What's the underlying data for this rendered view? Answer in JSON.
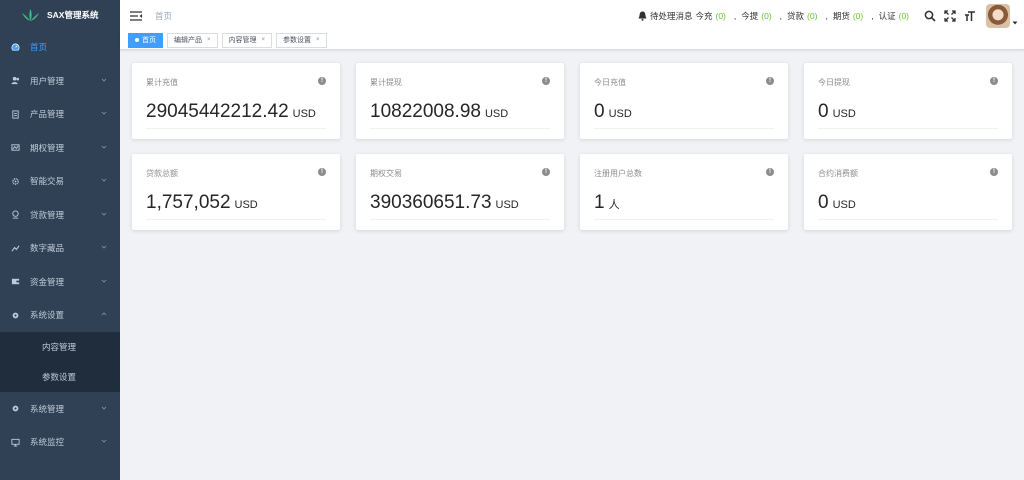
{
  "sidebar": {
    "logo_text": "SAX管理系统",
    "items": [
      {
        "label": "首页",
        "icon": "dashboard-icon"
      },
      {
        "label": "用户管理",
        "icon": "users-icon"
      },
      {
        "label": "产品管理",
        "icon": "document-icon"
      },
      {
        "label": "期权管理",
        "icon": "chart-icon"
      },
      {
        "label": "智能交易",
        "icon": "gear-icon"
      },
      {
        "label": "贷款管理",
        "icon": "loan-icon"
      },
      {
        "label": "数字藏品",
        "icon": "trend-icon"
      },
      {
        "label": "资金管理",
        "icon": "wallet-icon"
      },
      {
        "label": "系统设置",
        "icon": "settings-icon"
      },
      {
        "label": "系统管理",
        "icon": "settings-icon"
      },
      {
        "label": "系统监控",
        "icon": "monitor-icon"
      }
    ],
    "submenu": [
      {
        "label": "内容管理"
      },
      {
        "label": "参数设置"
      }
    ]
  },
  "header": {
    "breadcrumb": "首页",
    "notice_label": "待处理消息",
    "counters": [
      {
        "label": "今充",
        "count": "(0)"
      },
      {
        "label": "今提",
        "count": "(0)"
      },
      {
        "label": "贷款",
        "count": "(0)"
      },
      {
        "label": "期货",
        "count": "(0)"
      },
      {
        "label": "认证",
        "count": "(0)"
      }
    ],
    "separator": ","
  },
  "tags": [
    {
      "label": "首页",
      "active": true
    },
    {
      "label": "编辑产品",
      "close": "×"
    },
    {
      "label": "内容管理",
      "close": "×"
    },
    {
      "label": "参数设置",
      "close": "×"
    }
  ],
  "cards": [
    {
      "title": "累计充值",
      "value": "29045442212.42",
      "unit": "USD"
    },
    {
      "title": "累计提现",
      "value": "10822008.98",
      "unit": "USD"
    },
    {
      "title": "今日充值",
      "value": "0",
      "unit": "USD"
    },
    {
      "title": "今日提现",
      "value": "0",
      "unit": "USD"
    },
    {
      "title": "贷款总额",
      "value": "1,757,052",
      "unit": "USD"
    },
    {
      "title": "期权交易",
      "value": "390360651.73",
      "unit": "USD"
    },
    {
      "title": "注册用户总数",
      "value": "1",
      "unit": "人"
    },
    {
      "title": "合约消费额",
      "value": "0",
      "unit": "USD"
    }
  ],
  "colors": {
    "sidebar_bg": "#304156",
    "active": "#409eff",
    "count": "#67c23a"
  }
}
